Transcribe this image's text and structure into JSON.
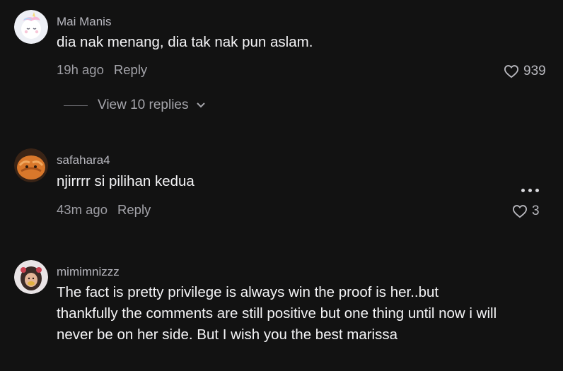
{
  "comments": [
    {
      "username": "Mai Manis",
      "text": "dia nak menang, dia tak nak pun aslam.",
      "time": "19h ago",
      "reply_label": "Reply",
      "likes": "939",
      "avatar_icon": "unicorn-avatar-icon"
    },
    {
      "username": "safahara4",
      "text": "njirrrr si pilihan kedua",
      "time": "43m ago",
      "reply_label": "Reply",
      "likes": "3",
      "avatar_icon": "cat-avatar-icon"
    },
    {
      "username": "mimimnizzz",
      "text": "The fact is pretty privilege is always win the proof is her..but thankfully the comments are still positive but one thing until now i will never be on her side. But I wish you the best marissa",
      "avatar_icon": "girl-avatar-icon"
    }
  ],
  "view_replies": {
    "label": "View 10 replies"
  },
  "colors": {
    "background": "#121212",
    "text": "#f4f4f6",
    "muted": "#9d9da3"
  }
}
